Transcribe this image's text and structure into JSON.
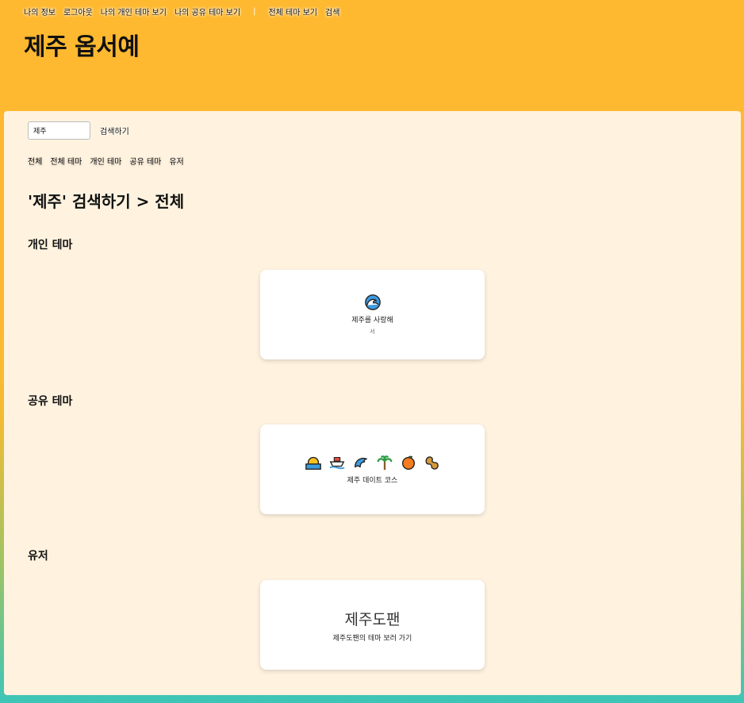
{
  "topnav": {
    "my_info": "나의 정보",
    "logout": "로그아웃",
    "my_personal_themes": "나의 개인 테마 보기",
    "my_shared_themes": "나의 공유 테마 보기",
    "separator": "|",
    "all_themes": "전체 테마 보기",
    "search": "검색"
  },
  "site_title": "제주 옵서예",
  "search": {
    "value": "제주",
    "button_label": "검색하기"
  },
  "filters": [
    "전체",
    "전체 테마",
    "개인 테마",
    "공유 테마",
    "유저"
  ],
  "result_heading": "'제주' 검색하기 > 전체",
  "sections": {
    "personal": {
      "title": "개인 테마",
      "card": {
        "icons": [
          "wave-icon"
        ],
        "name": "제주를 사랑해",
        "owner": "서"
      }
    },
    "shared": {
      "title": "공유 테마",
      "card": {
        "icons": [
          "sunrise-icon",
          "ship-icon",
          "dolphin-icon",
          "palm-tree-icon",
          "tangerine-icon",
          "peanut-icon"
        ],
        "name": "제주 데이트 코스"
      }
    },
    "users": {
      "title": "유저",
      "card": {
        "name": "제주도팬",
        "link": "제주도팬의 테마 보러 가기"
      }
    }
  },
  "colors": {
    "header_bg": "#ffb930",
    "panel_bg": "#fff3e0",
    "gradient_bottom": "#3cc5b8"
  }
}
